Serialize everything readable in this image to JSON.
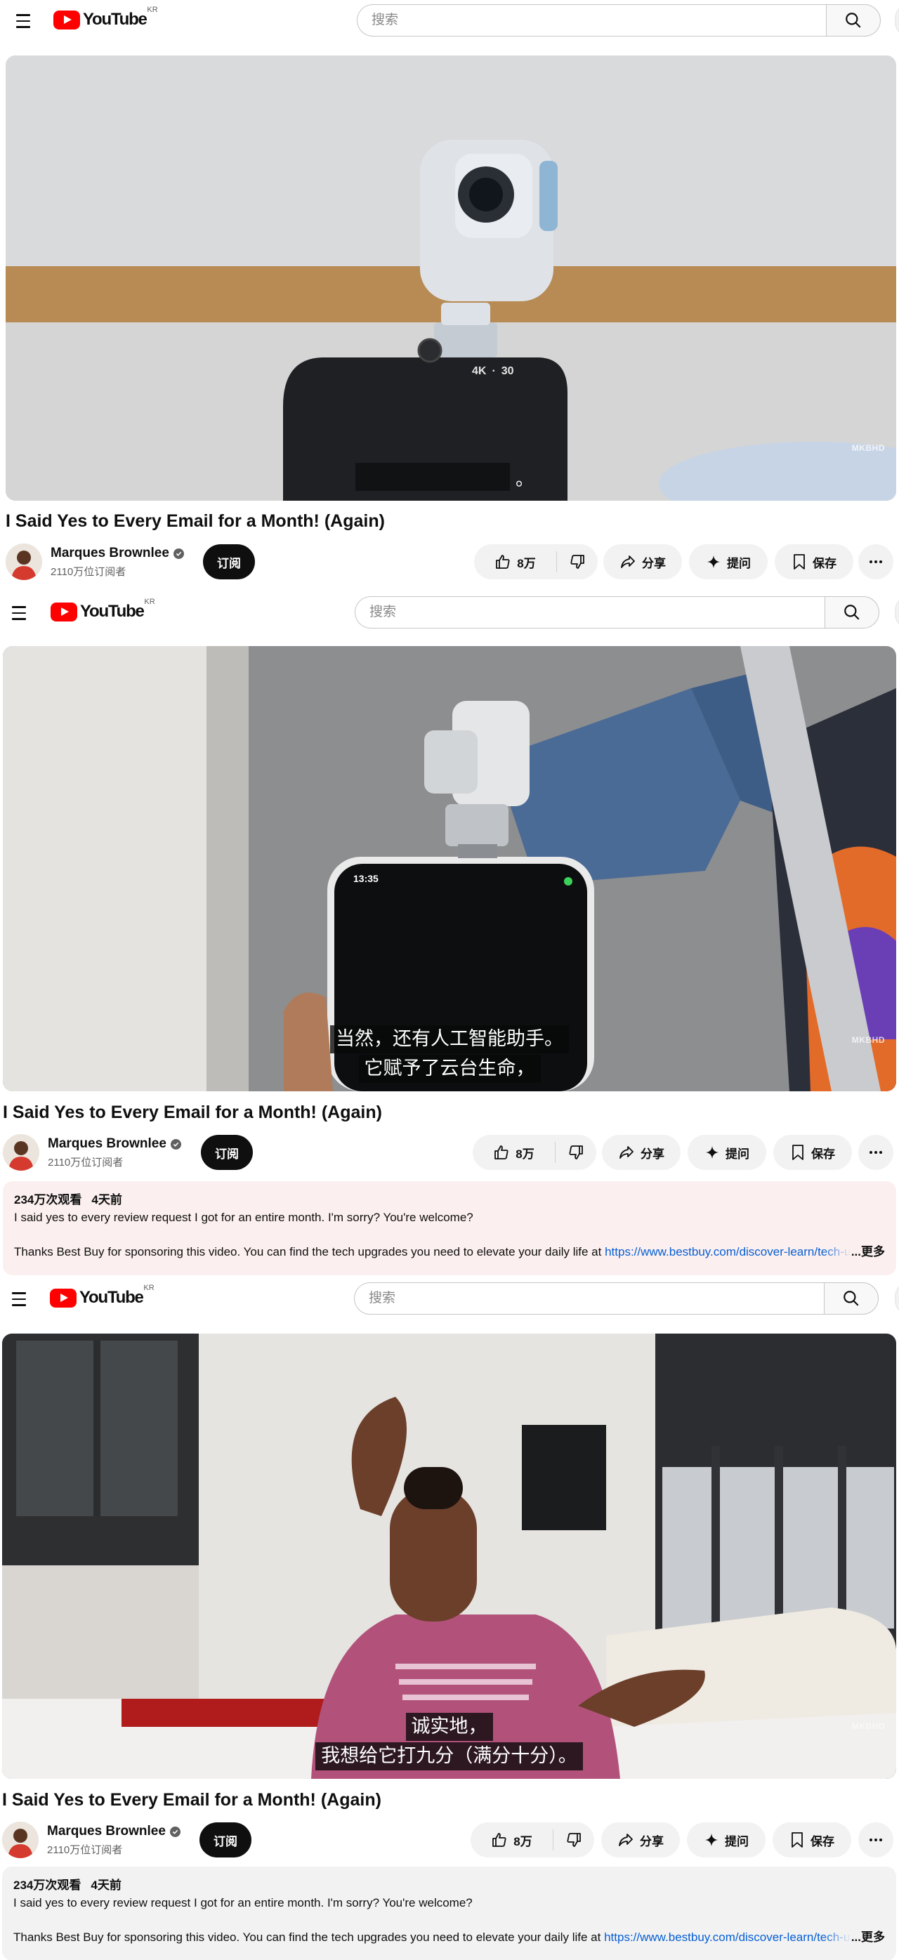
{
  "masthead": {
    "logo_text": "YouTube",
    "region": "KR",
    "search_placeholder": "搜索"
  },
  "video": {
    "title": "I Said Yes to Every Email for a Month! (Again)",
    "watermark": "MKBHD",
    "panel1_overlay": {
      "resolution": "4K",
      "separator": "·",
      "fps": "30"
    },
    "panel2_overlay": {
      "clock": "13:35"
    }
  },
  "captions": {
    "panel1": [
      "。"
    ],
    "panel2": [
      "当然，还有人工智能助手。",
      "它赋予了云台生命，"
    ],
    "panel3": [
      "诚实地，",
      "我想给它打九分（满分十分）。"
    ]
  },
  "channel": {
    "name": "Marques Brownlee",
    "subscribers": "2110万位订阅者",
    "subscribe_label": "订阅"
  },
  "actions": {
    "like_count": "8万",
    "share_label": "分享",
    "ask_label": "提问",
    "save_label": "保存"
  },
  "description": {
    "views": "234万次观看",
    "date": "4天前",
    "line1": "I said yes to every review request I got for an entire month. I'm sorry? You're welcome?",
    "line2_text": "Thanks Best Buy for sponsoring this video. You can find the tech upgrades you need to elevate your daily life at ",
    "line2_link": "https://www.bestbuy.com/discover-learn/tech-upgrades",
    "more_label": "...更多",
    "bg_expanded_hover": "#fcefef",
    "bg_default": "#f2f2f2"
  },
  "colors": {
    "brand_red": "#ff0000",
    "link": "#065fd4",
    "subscribe_bg": "#0f0f0f",
    "pill_bg": "#f2f2f2"
  },
  "icons": [
    "menu-icon",
    "youtube-logo-icon",
    "search-icon",
    "like-icon",
    "dislike-icon",
    "share-icon",
    "sparkle-icon",
    "bookmark-icon",
    "more-icon",
    "verified-icon"
  ]
}
